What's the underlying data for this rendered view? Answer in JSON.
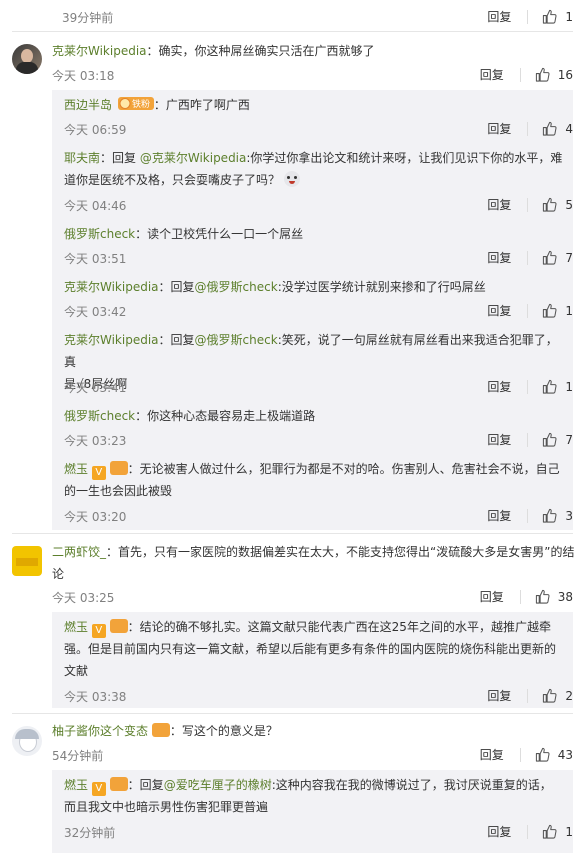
{
  "actions": {
    "reply_label": "回复"
  },
  "c0": {
    "time": "39分钟前",
    "likes": "1"
  },
  "c1": {
    "author": "克莱尔Wikipedia",
    "text": "：确实，你这种屌丝确实只活在广西就够了",
    "time": "今天 03:18",
    "likes": "16",
    "replies": [
      {
        "author": "西边半岛",
        "badge": "铁粉",
        "text": "：广西咋了啊广西",
        "time": "今天 06:59",
        "likes": "4"
      },
      {
        "author": "耶夫南",
        "text_prefix": "：回复 ",
        "mention": "@克莱尔Wikipedia",
        "text_line1": ":你学过你拿出论文和统计来呀，让我们见识下你的水平，难",
        "text_line2": "道你是医统不及格，只会耍嘴皮子了吗？",
        "time": "今天 04:46",
        "likes": "5"
      },
      {
        "author": "俄罗斯check",
        "text": "：读个卫校凭什么一口一个屌丝",
        "time": "今天 03:51",
        "likes": "7"
      },
      {
        "author": "克莱尔Wikipedia",
        "text_prefix": "：回复",
        "mention": "@俄罗斯check",
        "text": ":没学过医学统计就别来掺和了行吗屌丝",
        "time": "今天 03:42",
        "likes": "1"
      },
      {
        "author": "克莱尔Wikipedia",
        "text_prefix": "：回复",
        "mention": "@俄罗斯check",
        "text_line1": ":笑死，说了一句屌丝就有屌丝看出来我适合犯罪了，真",
        "text_line2": "是√8屌丝啊",
        "time": "今天 03:41",
        "likes": "1"
      },
      {
        "author": "俄罗斯check",
        "text": "：你这种心态最容易走上极端道路",
        "time": "今天 03:23",
        "likes": "7"
      },
      {
        "author": "燃玉",
        "text_line1": "：无论被害人做过什么，犯罪行为都是不对的哈。伤害别人、危害社会不说，自己",
        "text_line2": "的一生也会因此被毁",
        "time": "今天 03:20",
        "likes": "3"
      }
    ]
  },
  "c2": {
    "author": "二两虾饺_",
    "text_line1": "：首先，只有一家医院的数据偏差实在太大，不能支持您得出“泼硫酸大多是女害男”的结",
    "text_line2": "论",
    "time": "今天 03:25",
    "likes": "38",
    "replies": [
      {
        "author": "燃玉",
        "text_line1": "：结论的确不够扎实。这篇文献只能代表广西在这25年之间的水平，越推广越牵",
        "text_line2": "强。但是目前国内只有这一篇文献，希望以后能有更多有条件的国内医院的烧伤科能出更新的",
        "text_line3": "文献",
        "time": "今天 03:38",
        "likes": "2"
      }
    ]
  },
  "c3": {
    "author": "柚子酱你这个变态",
    "text": "：写这个的意义是？",
    "time": "54分钟前",
    "likes": "43",
    "replies": [
      {
        "author": "燃玉",
        "text_prefix": "：回复",
        "mention": "@爱吃车厘子的橡树",
        "text_line1": ":这种内容我在我的微博说过了，我讨厌说重复的话，",
        "text_line2": "而且我文中也暗示男性伤害犯罪更普遍",
        "time": "32分钟前",
        "likes": "1"
      }
    ]
  },
  "colors": {
    "name": "#5c7f2c",
    "reply_bg": "#f2f2f5",
    "badge_orange": "#f2a33a",
    "v_orange": "#f5a623"
  }
}
